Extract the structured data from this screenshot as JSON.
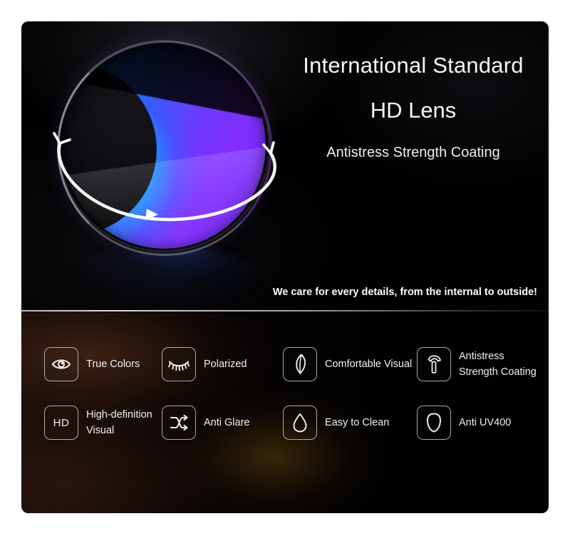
{
  "hero": {
    "title_line1": "International Standard",
    "title_line2": "HD Lens",
    "subtitle": "Antistress Strength Coating",
    "tagline": "We care for every details, from the internal to outside!",
    "lens_graphic": {
      "name": "hd-lens-sphere",
      "gradient_colors": [
        "#00d7ff",
        "#1668ff",
        "#4a52f2",
        "#7a34ee",
        "#3a1a78"
      ],
      "orbit_ring_color": "#ffffff"
    }
  },
  "features": {
    "row1": [
      {
        "icon": "eye-icon",
        "label": "True Colors"
      },
      {
        "icon": "eyelash-icon",
        "label": "Polarized"
      },
      {
        "icon": "feather-icon",
        "label": "Comfortable Visual"
      },
      {
        "icon": "hammer-icon",
        "label": "Antistress Strength Coating"
      }
    ],
    "row2": [
      {
        "icon": "hd-text-icon",
        "label": "High-definition Visual",
        "icon_text": "HD"
      },
      {
        "icon": "shuffle-icon",
        "label": "Anti Glare"
      },
      {
        "icon": "water-drop-icon",
        "label": "Easy to Clean"
      },
      {
        "icon": "shield-icon",
        "label": "Anti UV400"
      }
    ]
  },
  "colors": {
    "background": "#ffffff",
    "card_background": "#000000",
    "text": "#ffffff",
    "icon_stroke": "#dad6d4",
    "divider": "#e1dcd7",
    "warm_glow": "#60341e"
  }
}
